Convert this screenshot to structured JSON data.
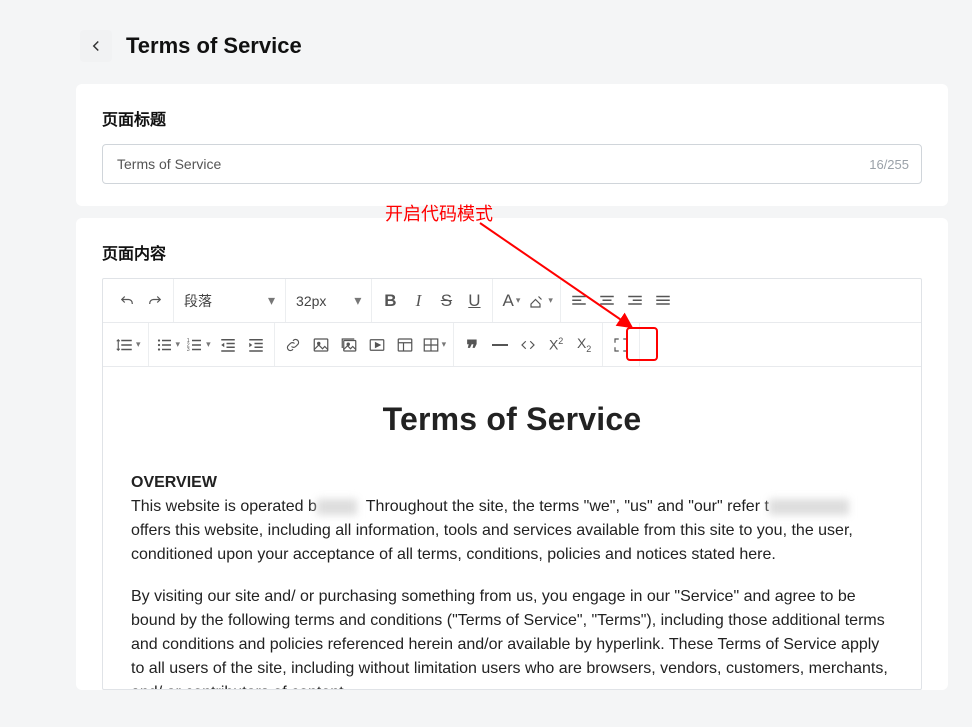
{
  "header": {
    "title": "Terms of Service"
  },
  "titleCard": {
    "label": "页面标题",
    "value": "Terms of Service",
    "counter": "16/255"
  },
  "annotation": {
    "text": "开启代码模式"
  },
  "contentCard": {
    "label": "页面内容"
  },
  "toolbar": {
    "paragraph": "段落",
    "fontsize": "32px"
  },
  "editor": {
    "heading": "Terms of Service",
    "overview_label": "OVERVIEW",
    "p1_a": "This website is operated b",
    "p1_b": "Throughout the site, the terms \"we\", \"us\" and \"our\" refer t",
    "p1_c": "offers this website, including all information, tools and services available from this site to you, the user, conditioned upon your acceptance of all terms, conditions, policies and notices stated here.",
    "p2": "By visiting our site and/ or purchasing something from us, you engage in our \"Service\" and agree to be bound by the following terms and conditions (\"Terms of Service\", \"Terms\"), including those additional terms and conditions and policies referenced herein and/or available by hyperlink. These Terms of Service apply to all users of the site, including without limitation users who are browsers, vendors, customers, merchants, and/ or contributors of content."
  }
}
